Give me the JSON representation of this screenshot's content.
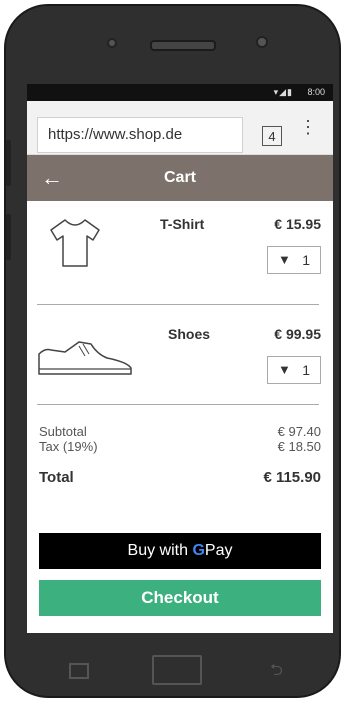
{
  "status_bar": {
    "time": "8:00",
    "icons": "▾◢▮"
  },
  "browser": {
    "url": "https://www.shop.de",
    "tab_count": "4",
    "menu_icon": "⋮"
  },
  "app_bar": {
    "back_icon": "←",
    "title": "Cart"
  },
  "items": [
    {
      "name": "T-Shirt",
      "price": "€ 15.95",
      "qty": "1",
      "icon": "tshirt-icon"
    },
    {
      "name": "Shoes",
      "price": "€ 99.95",
      "qty": "1",
      "icon": "shoe-icon"
    }
  ],
  "qty_arrow": "▼",
  "summary": {
    "subtotal_label": "Subtotal",
    "subtotal": "€ 97.40",
    "tax_label": "Tax (19%)",
    "tax": "€ 18.50",
    "total_label": "Total",
    "total": "€ 115.90"
  },
  "gpay": {
    "prefix": "Buy with",
    "g": "G",
    "suffix": "Pay"
  },
  "checkout": {
    "label": "Checkout"
  },
  "colors": {
    "app_bar": "#7c726b",
    "checkout": "#3db07f",
    "gpay_bg": "#000000"
  }
}
